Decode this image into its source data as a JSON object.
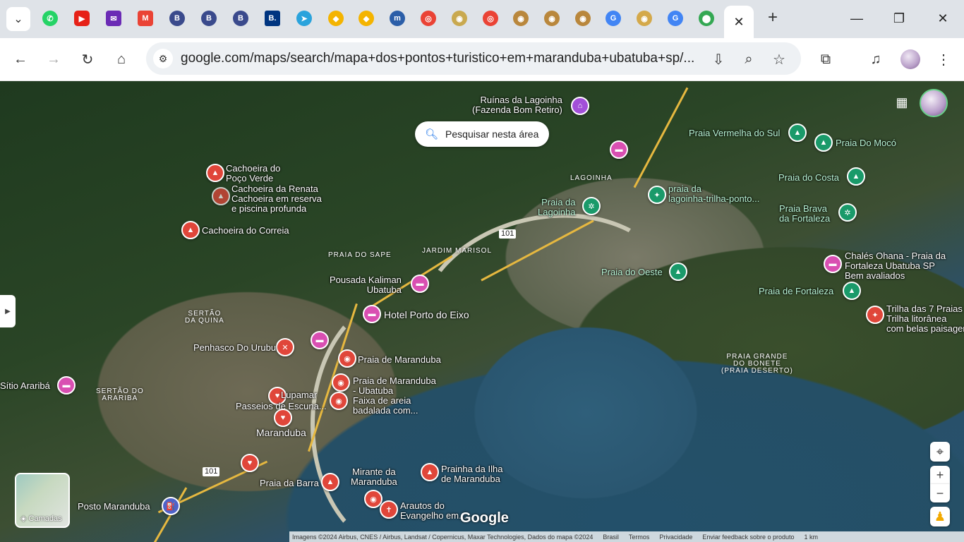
{
  "tabs": {
    "active_close": "✕",
    "new_tab": "+"
  },
  "window": {
    "minimize": "—",
    "restore": "❐",
    "close": "✕"
  },
  "toolbar": {
    "url": "google.com/maps/search/mapa+dos+pontos+turistico+em+maranduba+ubatuba+sp/..."
  },
  "map": {
    "search_area": "Pesquisar nesta área",
    "layers_label": "Camadas",
    "google_logo": "Google",
    "places": {
      "ruinas": "Ruínas da Lagoinha",
      "ruinas2": "(Fazenda Bom Retiro)",
      "pocoverde": "Cachoeira do",
      "pocoverde2": "Poço Verde",
      "renata": "Cachoeira da Renata",
      "renata_sub": "Cachoeira em reserva",
      "renata_sub2": "e piscina profunda",
      "correia": "Cachoeira do Correia",
      "vermelha": "Praia Vermelha do Sul",
      "moco": "Praia Do Mocó",
      "costa": "Praia do Costa",
      "brava": "Praia Brava",
      "brava2": "da Fortaleza",
      "lagoinha_beach": "Praia da",
      "lagoinha_beach2": "Lagoinha",
      "trilha_lagoinha": "praia da",
      "trilha_lagoinha2": "lagoinha-trilha-ponto...",
      "oeste": "Praia do Oeste",
      "chales": "Chalés Ohana - Praia da",
      "chales2": "Fortaleza Ubatuba SP",
      "chales_sub": "Bem avaliados",
      "fortaleza": "Praia de Fortaleza",
      "trilha7": "Trilha das 7 Praias",
      "trilha7_sub": "Trilha litorânea",
      "trilha7_sub2": "com belas paisagens",
      "kaliman": "Pousada Kaliman",
      "kaliman2": "Ubatuba",
      "porto": "Hotel Porto do Eixo",
      "penhasco": "Penhasco Do Urubu",
      "maranduba_beach": "Praia de Maranduba",
      "maranduba_tuba": "Praia de Maranduba",
      "maranduba_tuba2": "- Ubatuba",
      "maranduba_tuba_sub": "Faixa de areia",
      "maranduba_tuba_sub2": "badalada com...",
      "lupamar": "Lupamar",
      "passeios": "Passeios de Escuna...",
      "maranduba": "Maranduba",
      "araribá": "Sítio Araribá",
      "barra": "Praia da Barra",
      "mirante": "Mirante da",
      "mirante2": "Maranduba",
      "prainha": "Prainha da Ilha",
      "prainha2": "de Maranduba",
      "arautos": "Arautos do",
      "arautos2": "Evangelho em...",
      "posto": "Posto Maranduba"
    },
    "areas": {
      "lagoinha": "LAGOINHA",
      "sape": "PRAIA DO SAPE",
      "marisol": "JARDIM MARISOL",
      "sertao_quina": "SERTÃO",
      "sertao_quina2": "DA QUINA",
      "sertao_arariba": "SERTÃO DO",
      "sertao_arariba2": "ARARIBA",
      "grande_bonete": "PRAIA GRANDE",
      "grande_bonete2": "DO BONETE",
      "grande_bonete3": "(PRAIA DESERTO)"
    },
    "roads": {
      "r1": "101",
      "r2": "101"
    },
    "footer": {
      "imagery": "Imagens ©2024 Airbus, CNES / Airbus, Landsat / Copernicus, Maxar Technologies, Dados do mapa ©2024",
      "country": "Brasil",
      "terms": "Termos",
      "privacy": "Privacidade",
      "feedback": "Enviar feedback sobre o produto",
      "scale": "1 km"
    }
  }
}
